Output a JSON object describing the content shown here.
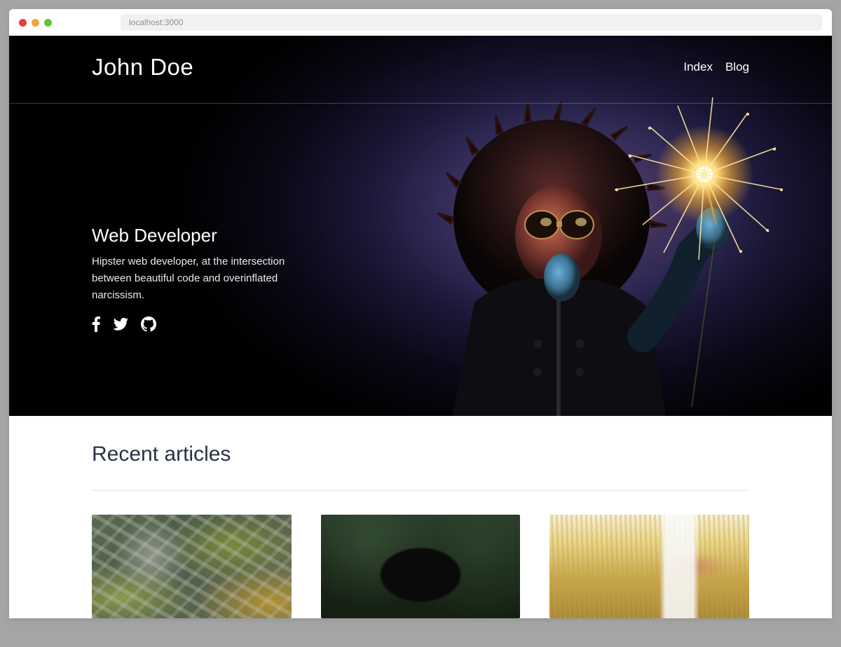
{
  "browser": {
    "url": "localhost:3000"
  },
  "header": {
    "title": "John Doe",
    "nav": [
      {
        "label": "Index"
      },
      {
        "label": "Blog"
      }
    ]
  },
  "hero": {
    "heading": "Web Developer",
    "subtitle": "Hipster web developer, at the intersection between beautiful code and overinflated narcissism.",
    "social": [
      {
        "name": "facebook-icon"
      },
      {
        "name": "twitter-icon"
      },
      {
        "name": "github-icon"
      }
    ]
  },
  "articles": {
    "heading": "Recent articles",
    "items": [
      {
        "thumb": "aerial-highway"
      },
      {
        "thumb": "forest-hat"
      },
      {
        "thumb": "golden-field"
      }
    ]
  }
}
